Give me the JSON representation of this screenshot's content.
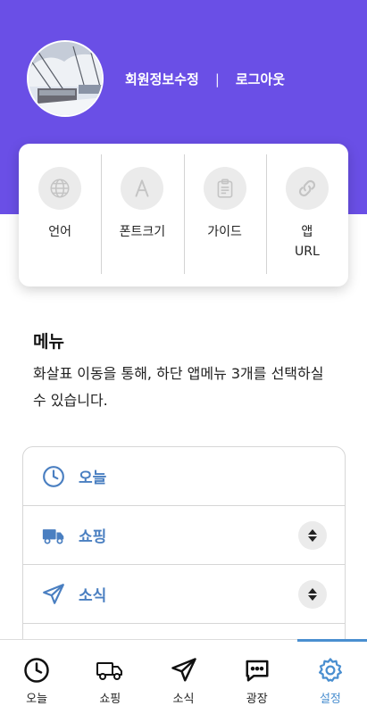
{
  "header": {
    "edit_profile": "회원정보수정",
    "separator": "|",
    "logout": "로그아웃"
  },
  "quick_actions": [
    {
      "label": "언어",
      "icon": "globe-icon"
    },
    {
      "label": "폰트크기",
      "icon": "font-a-icon"
    },
    {
      "label": "가이드",
      "icon": "clipboard-icon"
    },
    {
      "label": "앱\nURL",
      "icon": "link-icon"
    }
  ],
  "menu": {
    "title": "메뉴",
    "description": "화살표 이동을 통해, 하단 앱메뉴 3개를 선택하실 수 있습니다.",
    "items": [
      {
        "label": "오늘",
        "icon": "clock-icon"
      },
      {
        "label": "쇼핑",
        "icon": "truck-icon"
      },
      {
        "label": "소식",
        "icon": "paper-plane-icon"
      }
    ]
  },
  "tabbar": {
    "tabs": [
      {
        "label": "오늘",
        "icon": "clock-icon"
      },
      {
        "label": "쇼핑",
        "icon": "truck-icon"
      },
      {
        "label": "소식",
        "icon": "paper-plane-icon"
      },
      {
        "label": "광장",
        "icon": "chat-icon"
      },
      {
        "label": "설정",
        "icon": "gear-icon",
        "active": true
      }
    ]
  },
  "colors": {
    "header_bg": "#6a4fe6",
    "accent": "#4a8fd0",
    "menu_text": "#4a7fc1"
  }
}
